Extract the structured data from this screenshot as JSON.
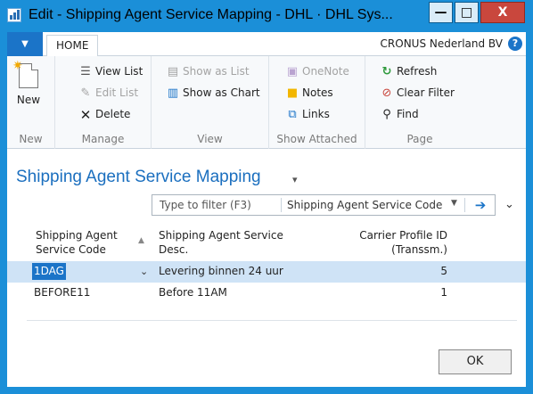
{
  "window": {
    "title": "Edit - Shipping Agent Service Mapping - DHL · DHL Sys...",
    "minimize_glyph": "—",
    "maximize_glyph": "□",
    "close_glyph": "X"
  },
  "ribbon": {
    "tab_home": "HOME",
    "company": "CRONUS Nederland BV",
    "help_glyph": "?",
    "groups": {
      "new": {
        "label": "New",
        "new_button": "New"
      },
      "manage": {
        "label": "Manage",
        "view_list": "View List",
        "edit_list": "Edit List",
        "delete": "Delete"
      },
      "view": {
        "label": "View",
        "show_as_list": "Show as List",
        "show_as_chart": "Show as Chart"
      },
      "show_attached": {
        "label": "Show Attached",
        "onenote": "OneNote",
        "notes": "Notes",
        "links": "Links"
      },
      "page": {
        "label": "Page",
        "refresh": "Refresh",
        "clear_filter": "Clear Filter",
        "find": "Find"
      }
    }
  },
  "page": {
    "title": "Shipping Agent Service Mapping"
  },
  "filter": {
    "placeholder": "Type to filter (F3)",
    "field": "Shipping Agent Service Code"
  },
  "grid": {
    "columns": [
      {
        "line1": "Shipping Agent",
        "line2": "Service Code"
      },
      {
        "line1": "Shipping Agent Service",
        "line2": "Desc."
      },
      {
        "line1": "Carrier Profile ID",
        "line2": "(Transsm.)"
      }
    ],
    "rows": [
      {
        "code": "1DAG",
        "desc": "Levering binnen 24 uur",
        "profile": "5"
      },
      {
        "code": "BEFORE11",
        "desc": "Before 11AM",
        "profile": "1"
      }
    ]
  },
  "footer": {
    "ok_label": "OK"
  },
  "colors": {
    "title_bar": "#1b8fd8",
    "accent": "#1b74c8",
    "selected_row": "#cfe3f6",
    "page_title": "#1b6fbf"
  }
}
